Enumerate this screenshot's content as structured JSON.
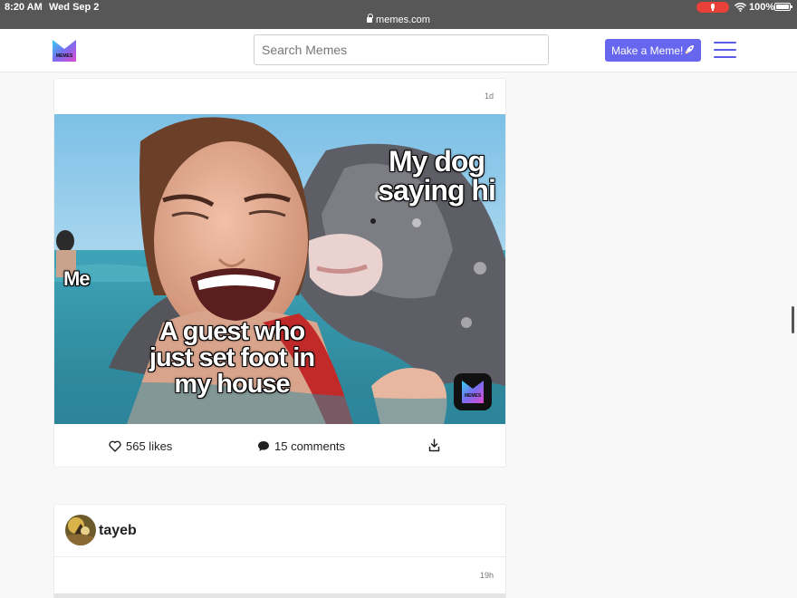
{
  "status_bar": {
    "time": "8:20 AM",
    "date": "Wed Sep 2",
    "url": "memes.com",
    "battery": "100%"
  },
  "navbar": {
    "logo_text": "MEMES",
    "search_placeholder": "Search Memes",
    "make_button_label": "Make a Meme!"
  },
  "posts": [
    {
      "time_ago": "1d",
      "captions": {
        "top_right": "My dog saying hi",
        "left": "Me",
        "bottom": "A guest who just set foot in my house"
      },
      "watermark_text": "MEMES",
      "likes_label": "565 likes",
      "comments_label": "15 comments"
    },
    {
      "username": "tayeb",
      "time_ago": "19h"
    }
  ],
  "colors": {
    "accent": "#6666ee",
    "status_bar": "#575757",
    "mic_indicator": "#e8413a"
  }
}
